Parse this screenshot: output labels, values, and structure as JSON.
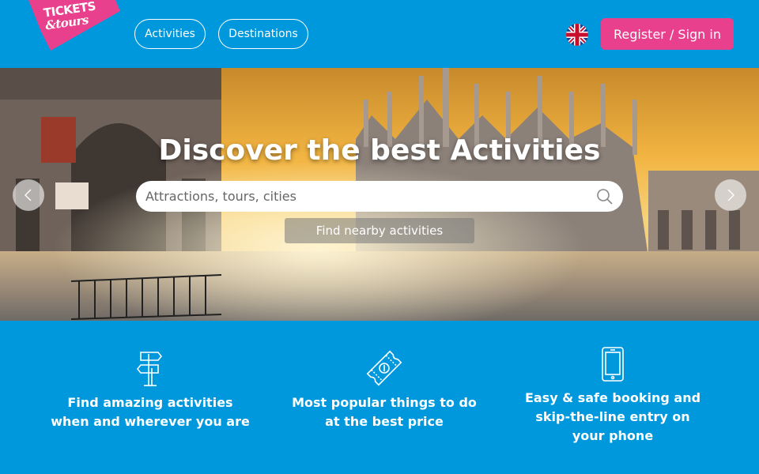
{
  "header": {
    "logo_line1": "TICKETS",
    "logo_line2": "&tours",
    "nav": [
      "Activities",
      "Destinations"
    ],
    "language_icon": "uk-flag-icon",
    "register_label": "Register / Sign in"
  },
  "hero": {
    "title": "Discover the best Activities",
    "search_placeholder": "Attractions, tours, cities",
    "nearby_label": "Find nearby activities",
    "prev_icon": "chevron-left-icon",
    "next_icon": "chevron-right-icon"
  },
  "features": [
    {
      "icon": "signpost-icon",
      "line1": "Find amazing activities",
      "line2": "when and wherever you are",
      "line3": ""
    },
    {
      "icon": "discount-ticket-icon",
      "line1": "Most popular things to do",
      "line2": "at the best price",
      "line3": ""
    },
    {
      "icon": "smartphone-icon",
      "line1": "Easy & safe booking and",
      "line2": "skip-the-line entry on",
      "line3": "your phone"
    }
  ],
  "colors": {
    "brand_blue": "#0098dc",
    "brand_pink": "#e8408c"
  }
}
